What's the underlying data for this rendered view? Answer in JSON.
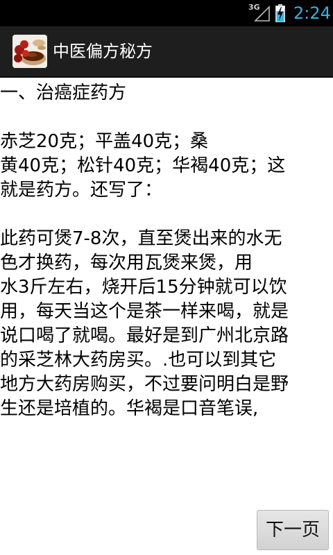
{
  "status_bar": {
    "network": "3G",
    "time": "2:24",
    "icons": [
      "signal-icon",
      "battery-charging-icon"
    ]
  },
  "action_bar": {
    "title": "中医偏方秘方",
    "icon": "app-icon"
  },
  "content": {
    "heading": "一、治癌症药方",
    "paragraph1": "赤芝20克；平盖40克；桑\n黄40克；松针40克；华褐40克；这\n就是药方。还写了：",
    "paragraph2": "此药可煲7-8次，直至煲出来的水无\n色才换药，每次用瓦煲来煲，用\n水3斤左右，烧开后15分钟就可以饮\n用，每天当这个是茶一样来喝，就是\n说口喝了就喝。最好是到广州北京路\n的采芝林大药房买。.也可以到其它\n地方大药房购买，不过要问明白是野\n生还是培植的。华褐是口音笔误,"
  },
  "buttons": {
    "next_page": "下一页"
  },
  "colors": {
    "status_time": "#33b5e5",
    "action_bar_bg": "#1e1e1e"
  }
}
